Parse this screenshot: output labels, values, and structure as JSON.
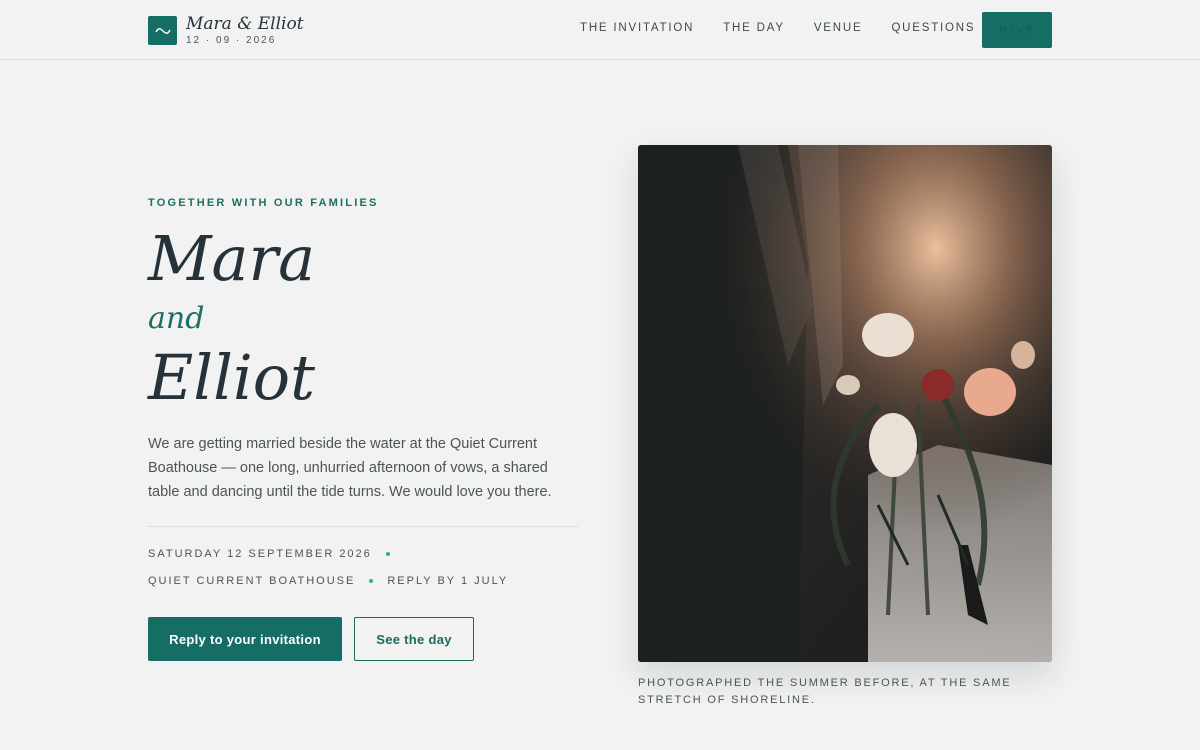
{
  "brand": {
    "name": "Mara & Elliot",
    "date": "12 · 09 · 2026",
    "logo_icon": "wave-icon"
  },
  "nav": {
    "items": [
      {
        "label": "THE INVITATION"
      },
      {
        "label": "THE DAY"
      },
      {
        "label": "VENUE"
      },
      {
        "label": "QUESTIONS"
      }
    ],
    "rsvp_label": "RSVP"
  },
  "hero": {
    "eyebrow": "TOGETHER WITH OUR FAMILIES",
    "name_1": "Mara",
    "conjunction": "and",
    "name_2": "Elliot",
    "intro": "We are getting married beside the water at the Quiet Current Boathouse — one long, unhurried afternoon of vows, a shared table and dancing until the tide turns. We would love you there.",
    "details": {
      "date": "SATURDAY 12 SEPTEMBER 2026",
      "venue": "QUIET CURRENT BOATHOUSE",
      "reply_by": "REPLY BY 1 JULY"
    },
    "primary_button": "Reply to your invitation",
    "secondary_button": "See the day"
  },
  "photo": {
    "caption": "PHOTOGRAPHED THE SUMMER BEFORE, AT THE SAME STRETCH OF SHORELINE."
  },
  "colors": {
    "accent": "#156d63",
    "background": "#f1f2f1",
    "dot": "#29b09b",
    "text": "#2a3438"
  }
}
